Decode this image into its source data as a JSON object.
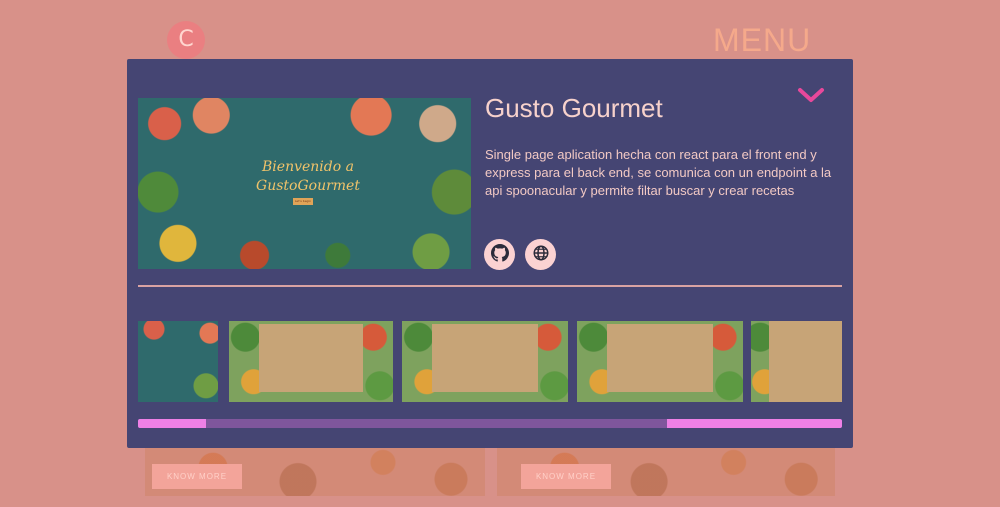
{
  "header": {
    "logo_letter": "C",
    "menu_label": "MENU"
  },
  "background_cards": {
    "know_more_label": "KNOW MORE"
  },
  "project": {
    "title": "Gusto Gourmet",
    "description": "Single page aplication hecha con react para el front end y express para el back end, se comunica con un endpoint a la api spoonacular y permite filtar buscar y crear recetas",
    "hero_image": {
      "heading": "Bienvenido a GustoGourmet",
      "button_label": "Let's begin"
    },
    "links": {
      "github_icon": "github-icon",
      "website_icon": "globe-icon"
    },
    "gallery": {
      "thumbnail_count": 5,
      "scroll_position_fraction": 0.1,
      "visible_fraction": 0.65
    }
  },
  "colors": {
    "page_bg": "#d89189",
    "modal_bg": "#454573",
    "title": "#f7d2cc",
    "chevron": "#e8489b",
    "scroll_track": "#ee80e6",
    "scroll_thumb": "#7f569c"
  }
}
